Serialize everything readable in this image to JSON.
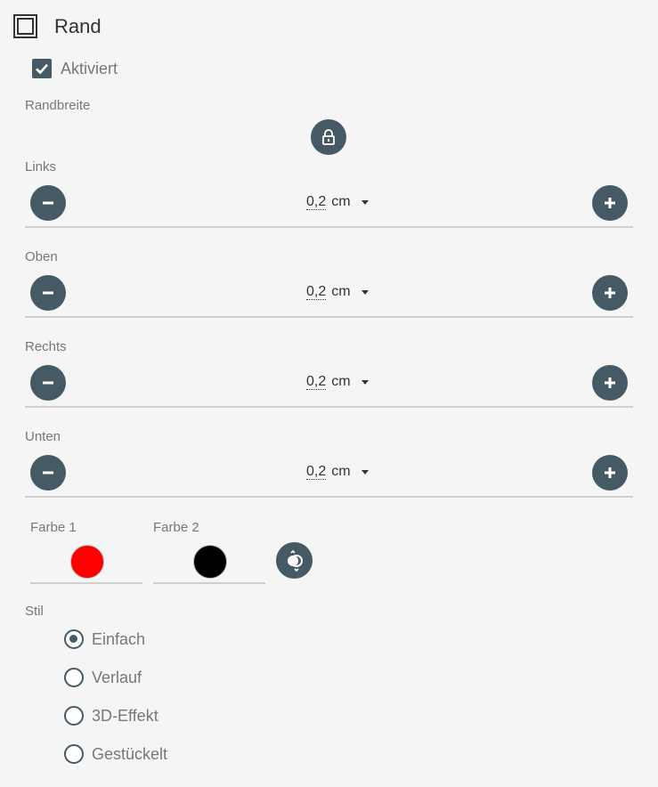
{
  "header": {
    "title": "Rand",
    "icon": "border-square-icon"
  },
  "enabled": {
    "label": "Aktiviert",
    "checked": true
  },
  "width_section": {
    "label": "Randbreite",
    "lock_icon": "lock-icon"
  },
  "sides": [
    {
      "label": "Links",
      "value": "0,2",
      "unit": "cm"
    },
    {
      "label": "Oben",
      "value": "0,2",
      "unit": "cm"
    },
    {
      "label": "Rechts",
      "value": "0,2",
      "unit": "cm"
    },
    {
      "label": "Unten",
      "value": "0,2",
      "unit": "cm"
    }
  ],
  "colors": {
    "color1": {
      "label": "Farbe 1",
      "value": "#ff0000"
    },
    "color2": {
      "label": "Farbe 2",
      "value": "#000000"
    },
    "swap_icon": "swap-colors-icon"
  },
  "style": {
    "label": "Stil",
    "options": [
      "Einfach",
      "Verlauf",
      "3D-Effekt",
      "Gestückelt"
    ],
    "selected": "Einfach"
  },
  "theme": {
    "accent": "#455a64"
  }
}
